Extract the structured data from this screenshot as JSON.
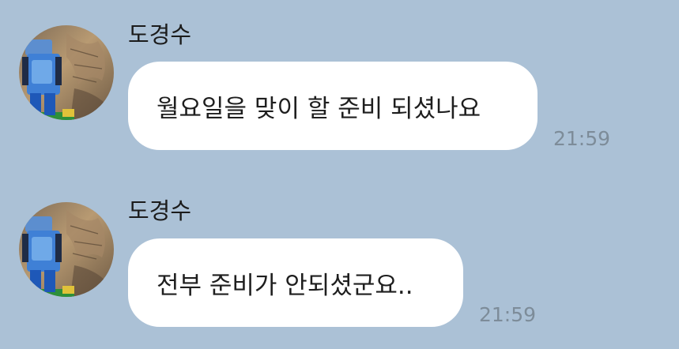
{
  "colors": {
    "background": "#abc1d6",
    "bubble": "#ffffff",
    "timestamp": "#7d8c99"
  },
  "messages": [
    {
      "sender": "도경수",
      "text": "월요일을 맞이 할 준비 되셨나요",
      "time": "21:59",
      "avatar_icon": "profile-photo-figurine-on-map"
    },
    {
      "sender": "도경수",
      "text": "전부 준비가 안되셨군요..",
      "time": "21:59",
      "avatar_icon": "profile-photo-figurine-on-map"
    }
  ]
}
